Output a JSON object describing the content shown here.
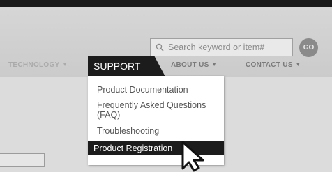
{
  "header": {
    "search": {
      "placeholder": "Search keyword or item#",
      "icon": "search-icon"
    },
    "go_label": "GO"
  },
  "nav": {
    "items": [
      {
        "label": "TECHNOLOGY",
        "icon": "chevron-down-icon"
      },
      {
        "label": "SUPPORT"
      },
      {
        "label": "ABOUT US",
        "icon": "chevron-down-icon"
      },
      {
        "label": "CONTACT US",
        "icon": "chevron-down-icon"
      }
    ]
  },
  "dropdown": {
    "items": [
      {
        "label": "Product Documentation"
      },
      {
        "label": "Frequently Asked Questions (FAQ)"
      },
      {
        "label": "Troubleshooting"
      },
      {
        "label": "Product Registration",
        "active": true
      }
    ]
  },
  "colors": {
    "nav_active_bg": "#1c1c1c",
    "text": "#555555",
    "background": "#d8d8d8"
  },
  "cursor": {
    "icon": "pointer-arrow-icon"
  }
}
